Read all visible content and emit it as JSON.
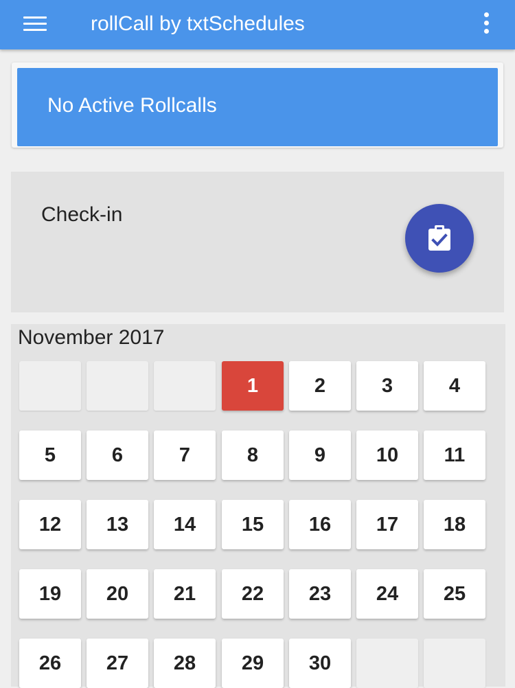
{
  "app_bar": {
    "title": "rollCall by txtSchedules",
    "menu_icon": "hamburger-menu-icon",
    "overflow_icon": "more-vert-icon",
    "color": "#4a94ea"
  },
  "rollcall_card": {
    "status_text": "No Active Rollcalls",
    "color": "#4a94ea"
  },
  "checkin_card": {
    "label": "Check-in",
    "fab_icon": "clipboard-check-icon",
    "fab_color": "#3f51b5"
  },
  "calendar": {
    "month_label": "November 2017",
    "today_color": "#d9463b",
    "weeks": [
      [
        "",
        "",
        "",
        "1",
        "2",
        "3",
        "4"
      ],
      [
        "5",
        "6",
        "7",
        "8",
        "9",
        "10",
        "11"
      ],
      [
        "12",
        "13",
        "14",
        "15",
        "16",
        "17",
        "18"
      ],
      [
        "19",
        "20",
        "21",
        "22",
        "23",
        "24",
        "25"
      ],
      [
        "26",
        "27",
        "28",
        "29",
        "30",
        "",
        ""
      ]
    ],
    "highlighted_day": "1"
  }
}
